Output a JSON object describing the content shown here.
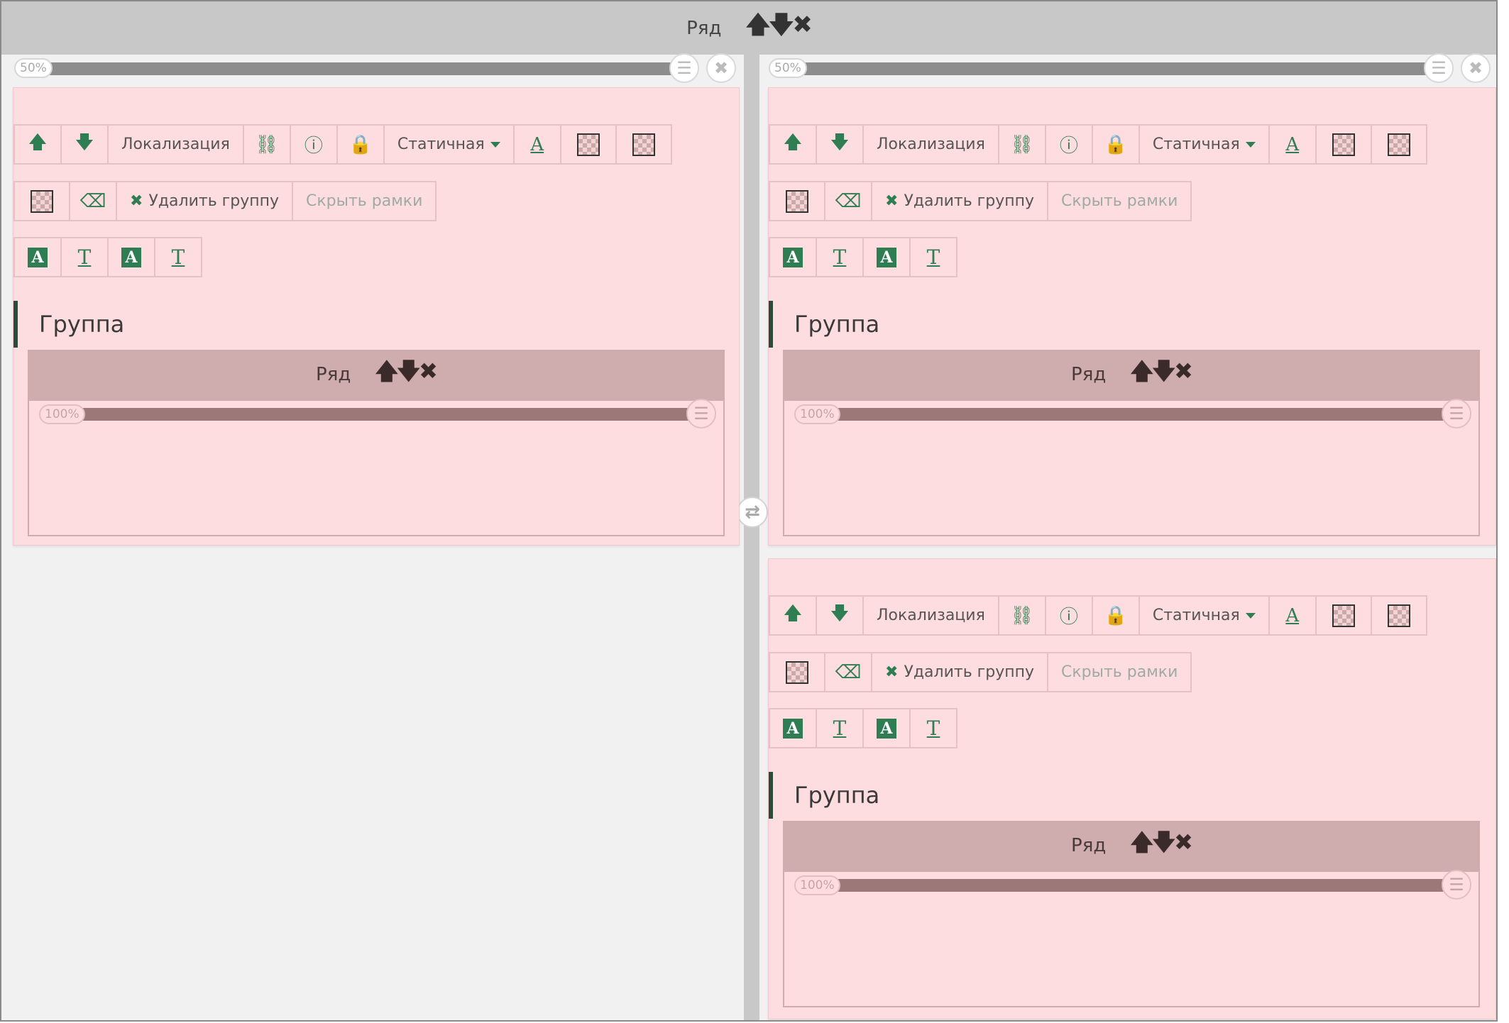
{
  "outer_row": {
    "label": "Ряд",
    "controls": "🡅🡇✖"
  },
  "columns": [
    {
      "width_label": "50%"
    },
    {
      "width_label": "50%"
    }
  ],
  "toolbar": {
    "localization": "Локализация",
    "static": "Статичная",
    "delete_group": "Удалить группу",
    "hide_frames": "Скрыть рамки",
    "font_letter": "A",
    "text_letter": "T"
  },
  "group": {
    "title": "Группа",
    "inner_row_label": "Ряд",
    "inner_row_controls": "🡅🡇✖",
    "inner_width_label": "100%"
  }
}
